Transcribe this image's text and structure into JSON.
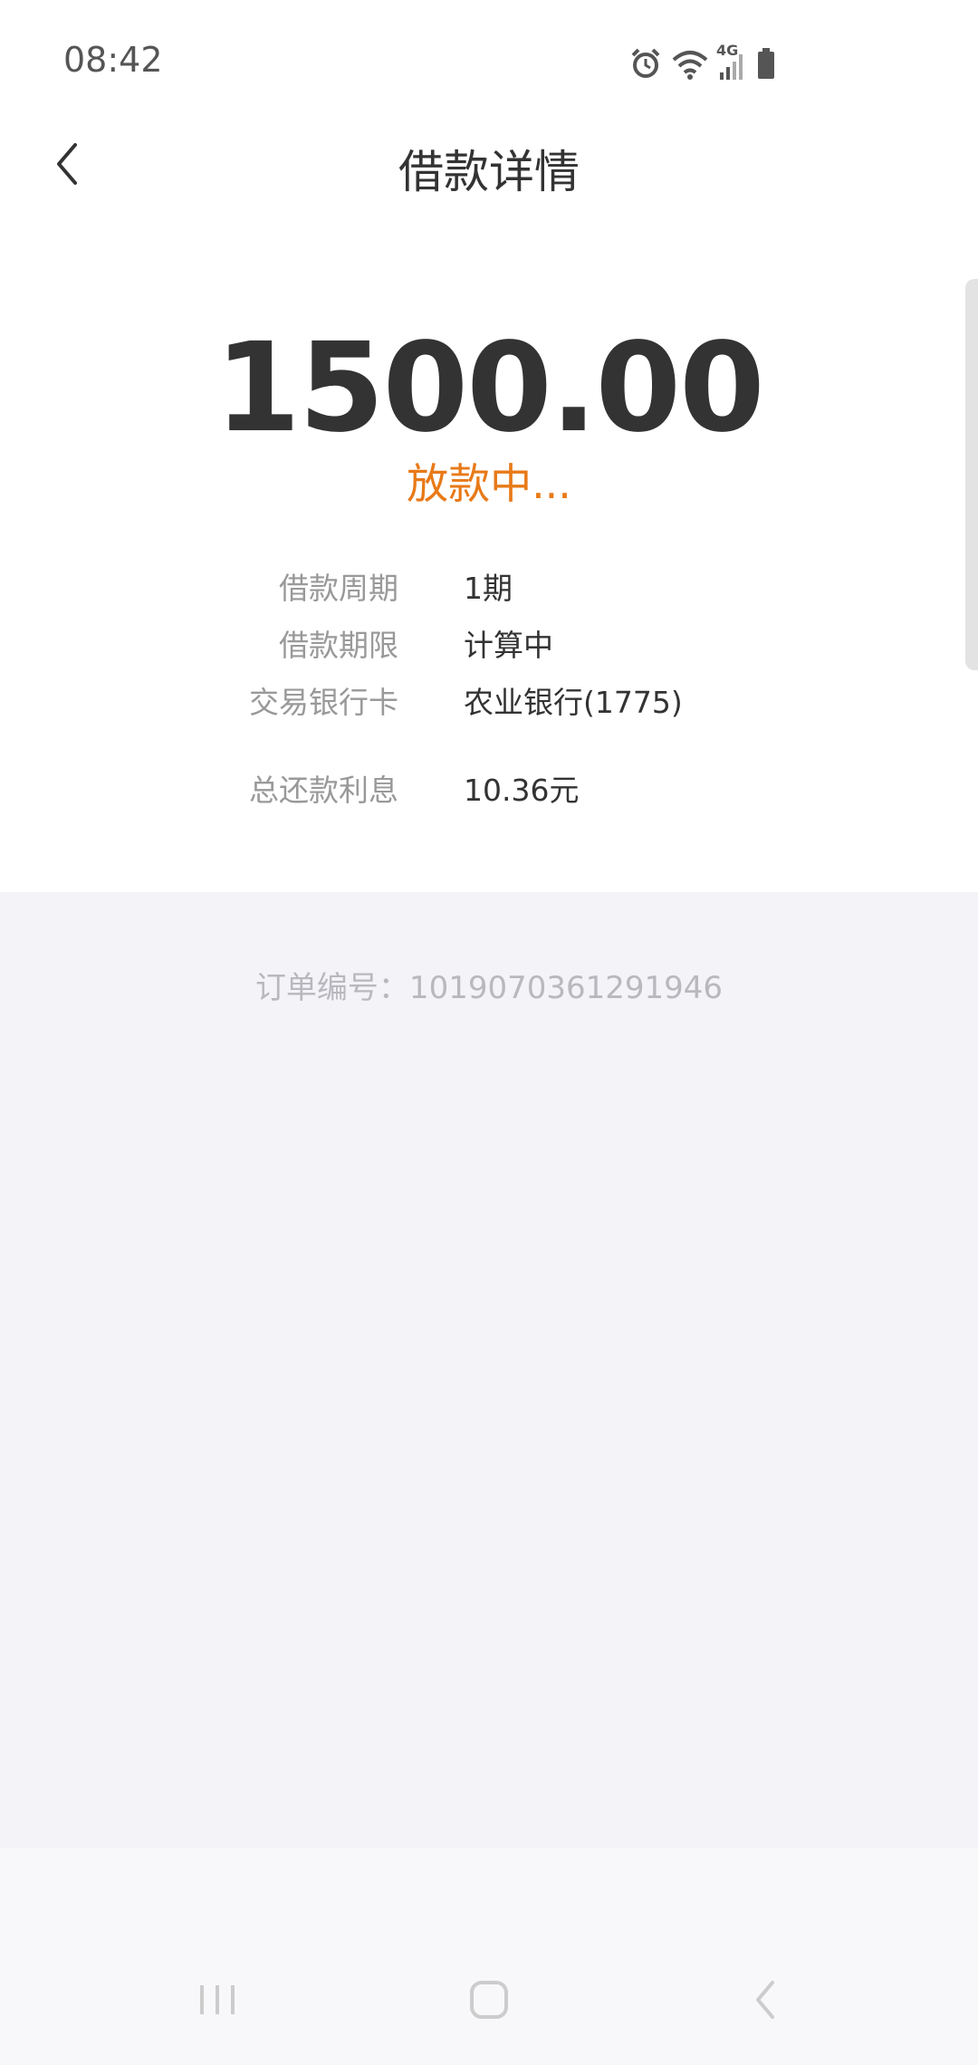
{
  "status_bar": {
    "time": "08:42",
    "network_label": "4G"
  },
  "header": {
    "title": "借款详情"
  },
  "loan": {
    "amount": "1500.00",
    "status": "放款中...",
    "details": [
      {
        "label": "借款周期",
        "value": "1期"
      },
      {
        "label": "借款期限",
        "value": "计算中"
      },
      {
        "label": "交易银行卡",
        "value": "农业银行(1775)"
      },
      {
        "label": "总还款利息",
        "value": "10.36元"
      }
    ]
  },
  "order": {
    "text": "订单编号：1019070361291946"
  },
  "colors": {
    "accent_orange": "#e87a18",
    "text_dark": "#333333",
    "label_gray": "#999999",
    "background_gray": "#f3f3f8"
  },
  "icons": {
    "back": "chevron-left-icon",
    "alarm": "alarm-icon",
    "wifi": "wifi-icon",
    "signal": "signal-icon",
    "battery": "battery-icon",
    "recent_apps": "recent-apps-icon",
    "home": "home-icon",
    "system_back": "system-back-icon"
  }
}
